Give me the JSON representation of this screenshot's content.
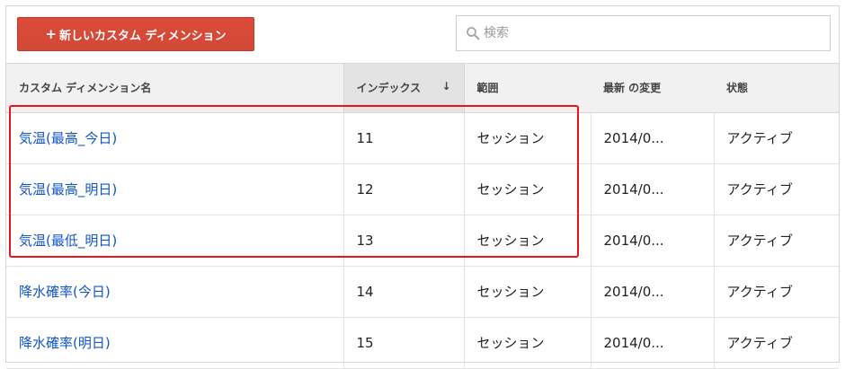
{
  "toolbar": {
    "new_button_plus": "+",
    "new_button_label": "新しいカスタム ディメンション",
    "search_placeholder": "検索",
    "search_value": ""
  },
  "table": {
    "columns": [
      {
        "label": "カスタム ディメンション名"
      },
      {
        "label": "インデックス",
        "sort_indicator": "↓"
      },
      {
        "label": "範囲"
      },
      {
        "label": "最新 の変更"
      },
      {
        "label": "状態"
      }
    ],
    "rows": [
      {
        "name": "気温(最高_今日)",
        "index": "11",
        "scope": "セッション",
        "last_changed": "2014/0...",
        "status": "アクティブ"
      },
      {
        "name": "気温(最高_明日)",
        "index": "12",
        "scope": "セッション",
        "last_changed": "2014/0...",
        "status": "アクティブ"
      },
      {
        "name": "気温(最低_明日)",
        "index": "13",
        "scope": "セッション",
        "last_changed": "2014/0...",
        "status": "アクティブ"
      },
      {
        "name": "降水確率(今日)",
        "index": "14",
        "scope": "セッション",
        "last_changed": "2014/0...",
        "status": "アクティブ"
      },
      {
        "name": "降水確率(明日)",
        "index": "15",
        "scope": "セッション",
        "last_changed": "2014/0...",
        "status": "アクティブ"
      }
    ]
  },
  "colors": {
    "primary_button": "#d14836",
    "link": "#1155cc",
    "highlight_outline": "#e8141c",
    "header_bg": "#f1f1f1",
    "sorted_header_bg": "#e3e3e3"
  }
}
